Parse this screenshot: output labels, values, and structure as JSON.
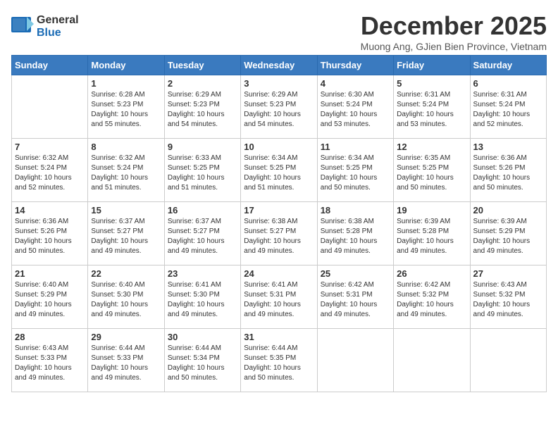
{
  "logo": {
    "general": "General",
    "blue": "Blue"
  },
  "title": "December 2025",
  "subtitle": "Muong Ang, GJien Bien Province, Vietnam",
  "weekdays": [
    "Sunday",
    "Monday",
    "Tuesday",
    "Wednesday",
    "Thursday",
    "Friday",
    "Saturday"
  ],
  "weeks": [
    [
      {
        "day": "",
        "info": ""
      },
      {
        "day": "1",
        "info": "Sunrise: 6:28 AM\nSunset: 5:23 PM\nDaylight: 10 hours\nand 55 minutes."
      },
      {
        "day": "2",
        "info": "Sunrise: 6:29 AM\nSunset: 5:23 PM\nDaylight: 10 hours\nand 54 minutes."
      },
      {
        "day": "3",
        "info": "Sunrise: 6:29 AM\nSunset: 5:23 PM\nDaylight: 10 hours\nand 54 minutes."
      },
      {
        "day": "4",
        "info": "Sunrise: 6:30 AM\nSunset: 5:24 PM\nDaylight: 10 hours\nand 53 minutes."
      },
      {
        "day": "5",
        "info": "Sunrise: 6:31 AM\nSunset: 5:24 PM\nDaylight: 10 hours\nand 53 minutes."
      },
      {
        "day": "6",
        "info": "Sunrise: 6:31 AM\nSunset: 5:24 PM\nDaylight: 10 hours\nand 52 minutes."
      }
    ],
    [
      {
        "day": "7",
        "info": "Sunrise: 6:32 AM\nSunset: 5:24 PM\nDaylight: 10 hours\nand 52 minutes."
      },
      {
        "day": "8",
        "info": "Sunrise: 6:32 AM\nSunset: 5:24 PM\nDaylight: 10 hours\nand 51 minutes."
      },
      {
        "day": "9",
        "info": "Sunrise: 6:33 AM\nSunset: 5:25 PM\nDaylight: 10 hours\nand 51 minutes."
      },
      {
        "day": "10",
        "info": "Sunrise: 6:34 AM\nSunset: 5:25 PM\nDaylight: 10 hours\nand 51 minutes."
      },
      {
        "day": "11",
        "info": "Sunrise: 6:34 AM\nSunset: 5:25 PM\nDaylight: 10 hours\nand 50 minutes."
      },
      {
        "day": "12",
        "info": "Sunrise: 6:35 AM\nSunset: 5:25 PM\nDaylight: 10 hours\nand 50 minutes."
      },
      {
        "day": "13",
        "info": "Sunrise: 6:36 AM\nSunset: 5:26 PM\nDaylight: 10 hours\nand 50 minutes."
      }
    ],
    [
      {
        "day": "14",
        "info": "Sunrise: 6:36 AM\nSunset: 5:26 PM\nDaylight: 10 hours\nand 50 minutes."
      },
      {
        "day": "15",
        "info": "Sunrise: 6:37 AM\nSunset: 5:27 PM\nDaylight: 10 hours\nand 49 minutes."
      },
      {
        "day": "16",
        "info": "Sunrise: 6:37 AM\nSunset: 5:27 PM\nDaylight: 10 hours\nand 49 minutes."
      },
      {
        "day": "17",
        "info": "Sunrise: 6:38 AM\nSunset: 5:27 PM\nDaylight: 10 hours\nand 49 minutes."
      },
      {
        "day": "18",
        "info": "Sunrise: 6:38 AM\nSunset: 5:28 PM\nDaylight: 10 hours\nand 49 minutes."
      },
      {
        "day": "19",
        "info": "Sunrise: 6:39 AM\nSunset: 5:28 PM\nDaylight: 10 hours\nand 49 minutes."
      },
      {
        "day": "20",
        "info": "Sunrise: 6:39 AM\nSunset: 5:29 PM\nDaylight: 10 hours\nand 49 minutes."
      }
    ],
    [
      {
        "day": "21",
        "info": "Sunrise: 6:40 AM\nSunset: 5:29 PM\nDaylight: 10 hours\nand 49 minutes."
      },
      {
        "day": "22",
        "info": "Sunrise: 6:40 AM\nSunset: 5:30 PM\nDaylight: 10 hours\nand 49 minutes."
      },
      {
        "day": "23",
        "info": "Sunrise: 6:41 AM\nSunset: 5:30 PM\nDaylight: 10 hours\nand 49 minutes."
      },
      {
        "day": "24",
        "info": "Sunrise: 6:41 AM\nSunset: 5:31 PM\nDaylight: 10 hours\nand 49 minutes."
      },
      {
        "day": "25",
        "info": "Sunrise: 6:42 AM\nSunset: 5:31 PM\nDaylight: 10 hours\nand 49 minutes."
      },
      {
        "day": "26",
        "info": "Sunrise: 6:42 AM\nSunset: 5:32 PM\nDaylight: 10 hours\nand 49 minutes."
      },
      {
        "day": "27",
        "info": "Sunrise: 6:43 AM\nSunset: 5:32 PM\nDaylight: 10 hours\nand 49 minutes."
      }
    ],
    [
      {
        "day": "28",
        "info": "Sunrise: 6:43 AM\nSunset: 5:33 PM\nDaylight: 10 hours\nand 49 minutes."
      },
      {
        "day": "29",
        "info": "Sunrise: 6:44 AM\nSunset: 5:33 PM\nDaylight: 10 hours\nand 49 minutes."
      },
      {
        "day": "30",
        "info": "Sunrise: 6:44 AM\nSunset: 5:34 PM\nDaylight: 10 hours\nand 50 minutes."
      },
      {
        "day": "31",
        "info": "Sunrise: 6:44 AM\nSunset: 5:35 PM\nDaylight: 10 hours\nand 50 minutes."
      },
      {
        "day": "",
        "info": ""
      },
      {
        "day": "",
        "info": ""
      },
      {
        "day": "",
        "info": ""
      }
    ]
  ]
}
